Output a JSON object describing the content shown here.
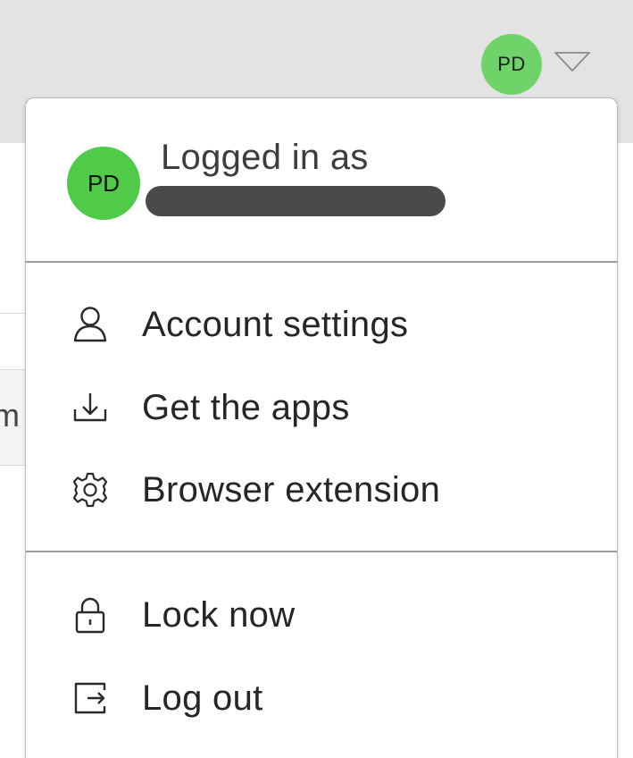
{
  "header": {
    "avatar_initials": "PD",
    "avatar_color": "#6fd36a",
    "menu_caret_icon": "chevron-down-outline-icon"
  },
  "background": {
    "partial_text": "m"
  },
  "menu": {
    "user": {
      "avatar_initials": "PD",
      "avatar_color": "#4fcb49",
      "logged_in_label": "Logged in as"
    },
    "items": [
      {
        "label": "Account settings",
        "icon": "user-icon"
      },
      {
        "label": "Get the apps",
        "icon": "download-icon"
      },
      {
        "label": "Browser extension",
        "icon": "gear-icon"
      },
      {
        "label": "Lock now",
        "icon": "lock-icon"
      },
      {
        "label": "Log out",
        "icon": "logout-icon"
      }
    ]
  }
}
